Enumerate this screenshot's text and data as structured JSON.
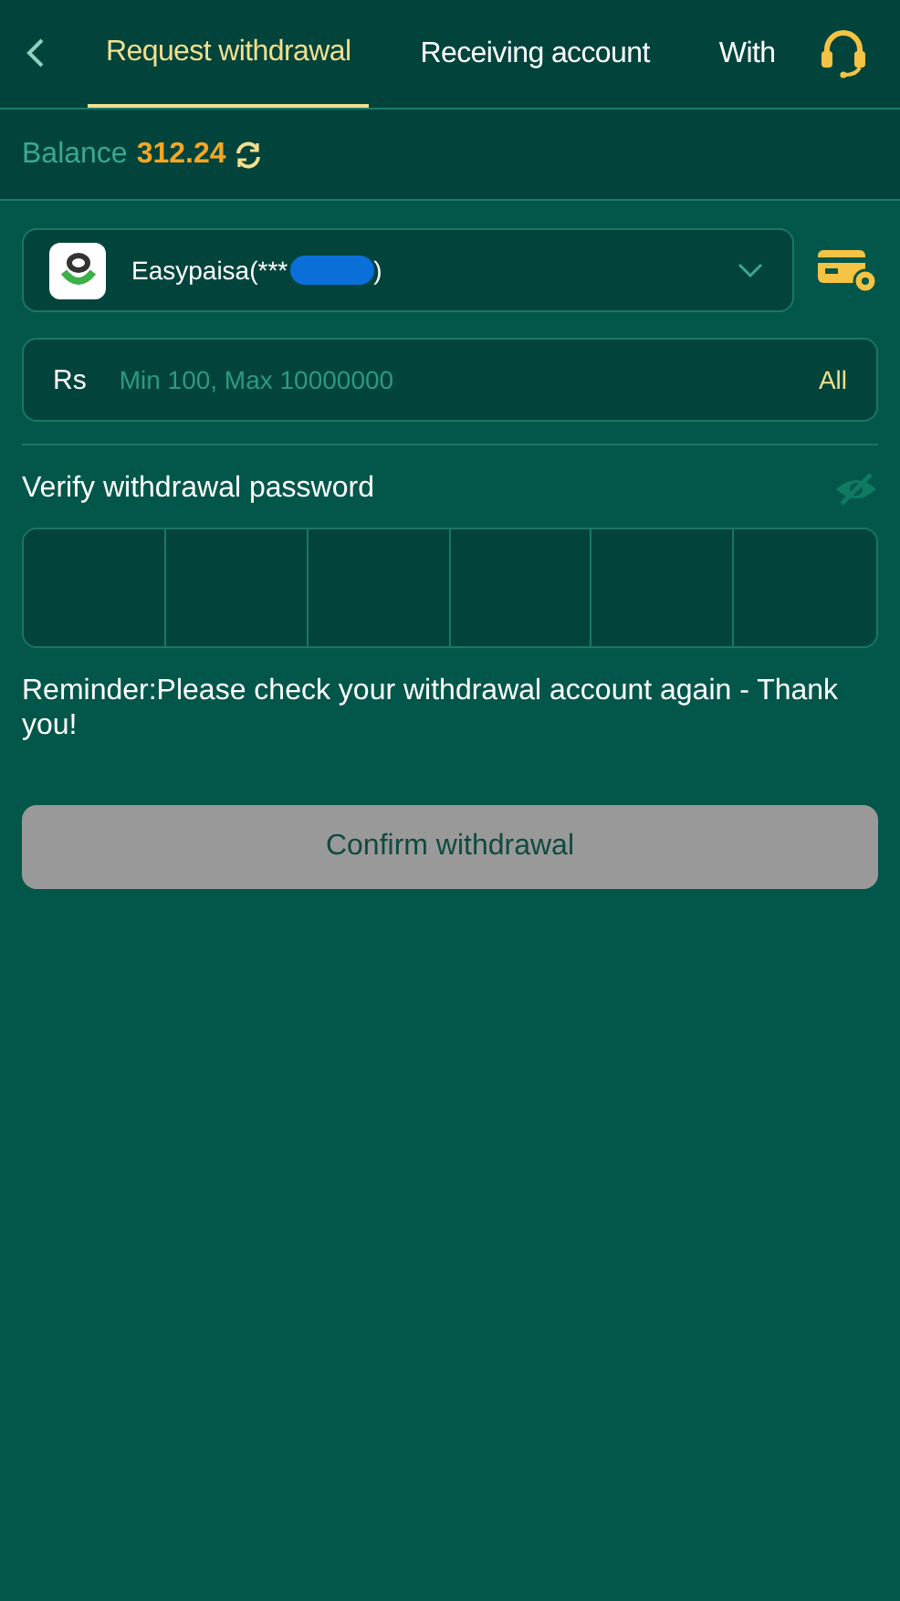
{
  "header": {
    "tabs": [
      {
        "label": "Request withdrawal",
        "selected": true
      },
      {
        "label": "Receiving account",
        "selected": false
      },
      {
        "label": "With",
        "selected": false
      }
    ]
  },
  "balance": {
    "label": "Balance",
    "amount": "312.24"
  },
  "account": {
    "name": "Easypaisa(***",
    "suffix": ")"
  },
  "amount": {
    "currency": "Rs",
    "placeholder": "Min 100, Max 10000000",
    "all_label": "All"
  },
  "password": {
    "label": "Verify withdrawal password"
  },
  "reminder": "Reminder:Please check your withdrawal account again - Thank you!",
  "confirm": {
    "label": "Confirm withdrawal",
    "disabled": true
  }
}
